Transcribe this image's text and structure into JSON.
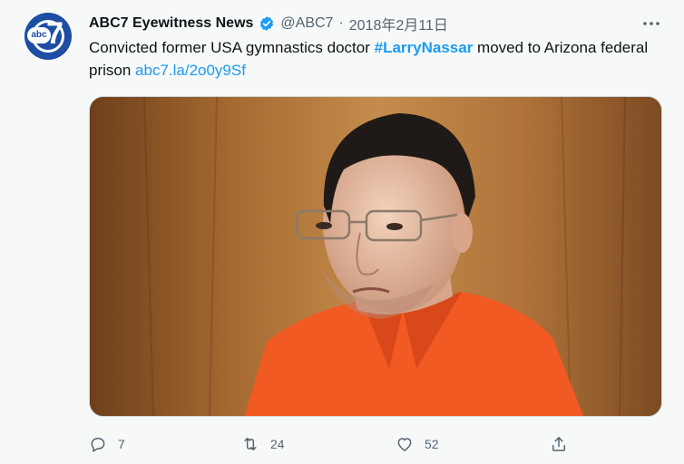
{
  "account": {
    "display_name": "ABC7 Eyewitness News",
    "handle": "@ABC7",
    "separator": "·",
    "date": "2018年2月11日",
    "avatar_text_small": "abc",
    "avatar_text_big": "7"
  },
  "tweet": {
    "text_before": "Convicted former USA gymnastics doctor ",
    "hashtag": "#LarryNassar",
    "text_after": " moved to Arizona federal prison ",
    "link": "abc7.la/2o0y9Sf"
  },
  "actions": {
    "reply_count": "7",
    "retweet_count": "24",
    "like_count": "52"
  },
  "colors": {
    "accent": "#1d9bf0",
    "muted": "#536471",
    "prison_orange": "#f15a22"
  },
  "icons": [
    "verified-badge-icon",
    "more-icon",
    "reply-icon",
    "retweet-icon",
    "like-icon",
    "share-icon"
  ]
}
